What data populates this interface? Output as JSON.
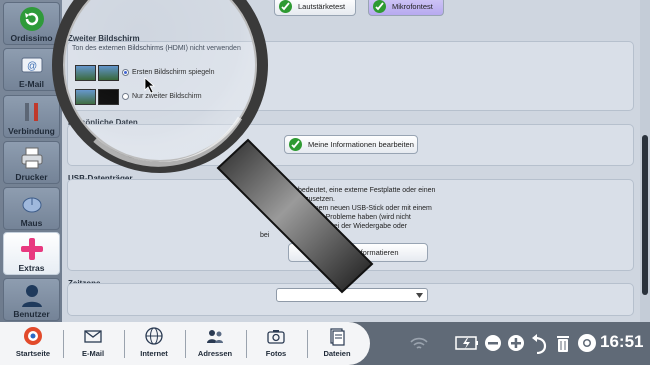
{
  "sidebar": {
    "items": [
      {
        "label": "Ordissimo",
        "icon": "refresh-icon"
      },
      {
        "label": "E-Mail",
        "icon": "email-icon"
      },
      {
        "label": "Verbindung",
        "icon": "tools-icon"
      },
      {
        "label": "Drucker",
        "icon": "printer-icon"
      },
      {
        "label": "Maus",
        "icon": "mouse-icon"
      },
      {
        "label": "Extras",
        "icon": "plus-icon"
      },
      {
        "label": "Benutzer",
        "icon": "user-icon"
      }
    ]
  },
  "audio": {
    "volume_test": "Lautstärketest",
    "mic_test": "Mikrofontest"
  },
  "second_screen": {
    "title": "Zweiter Bildschirm",
    "subtitle": "Ton des externen Bildschirms (HDMI) nicht verwenden",
    "option_mirror": "Ersten Bildschirm spiegeln",
    "option_only_second": "Nur zweiter Bildschirm"
  },
  "personal_data": {
    "title": "Persönliche Daten",
    "edit_button": "Meine Informationen bearbeiten"
  },
  "usb": {
    "title": "USB-Datenträger",
    "text_lines": [
      "bedeutet, eine externe Festplatte oder einen",
      "ckzusetzen.",
      "mit einem neuen USB-Stick oder mit einem",
      "dem Sie Probleme haben (wird nicht",
      "Probleme bei der Wiedergabe oder",
      "bei"
    ],
    "format_button": "räger formatieren"
  },
  "timezone": {
    "title": "Zeitzone",
    "selected": ""
  },
  "taskbar": {
    "items": [
      {
        "label": "Startseite",
        "icon": "home-icon"
      },
      {
        "label": "E-Mail",
        "icon": "envelope-icon"
      },
      {
        "label": "Internet",
        "icon": "globe-icon"
      },
      {
        "label": "Adressen",
        "icon": "contacts-icon"
      },
      {
        "label": "Fotos",
        "icon": "camera-icon"
      },
      {
        "label": "Dateien",
        "icon": "files-icon"
      }
    ],
    "clock": "16:51"
  },
  "colors": {
    "accent_check": "#2e9a32",
    "selected_button": "#b7a9ef",
    "extras_pink": "#e8397f"
  }
}
